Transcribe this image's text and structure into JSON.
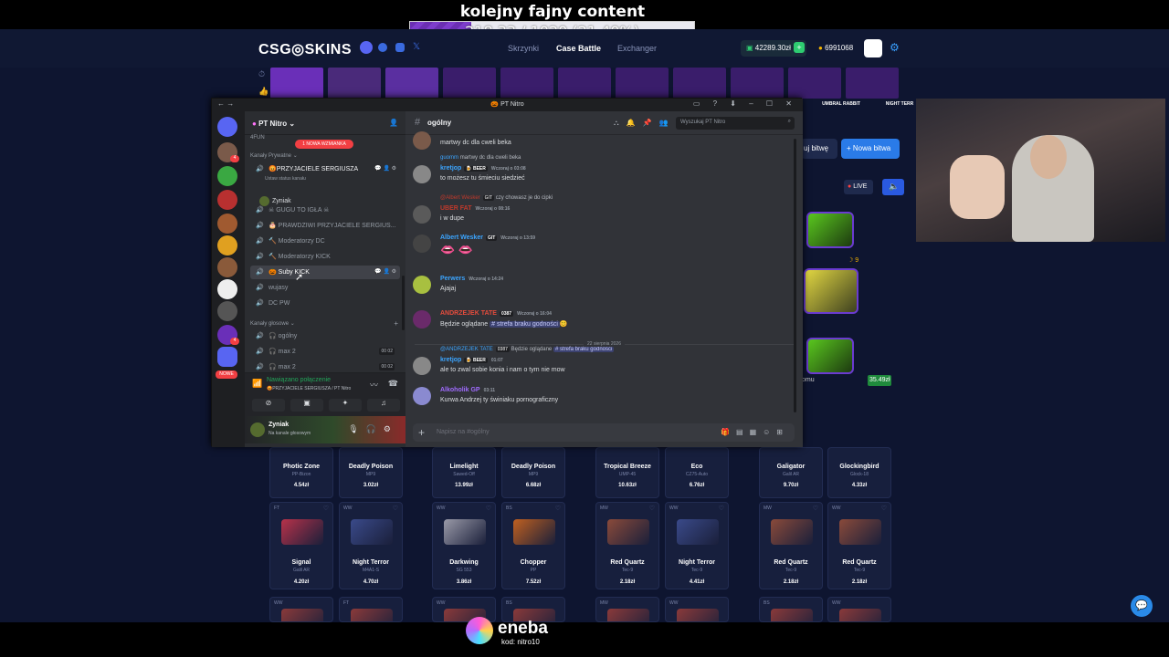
{
  "stream": {
    "title": "kolejny fajny content",
    "goal_text": "218.33 / 1020 (21.40%)",
    "goal_fraction": 0.214
  },
  "site": {
    "logo": "CSG◎SKINS",
    "nav": [
      "Skrzynki",
      "Case Battle",
      "Exchanger"
    ],
    "balance": "42289.30zł",
    "coins": "6991068",
    "join_label": "uj bitwę",
    "new_battle_label": "+ Nowa bitwa",
    "live_label": "LIVE",
    "right_label": "omu",
    "right_price": "35.49zł",
    "mini_count": "9",
    "drops": [
      {
        "color": "#6a2fb8"
      },
      {
        "color": "#4a2a7a"
      },
      {
        "color": "#5a2fa0"
      },
      {
        "color": "#3a1d6b"
      },
      {
        "color": "#3a1d6b"
      },
      {
        "color": "#3a1d6b"
      },
      {
        "color": "#3a1d6b"
      },
      {
        "color": "#3a1d6b"
      },
      {
        "color": "#3a1d6b"
      },
      {
        "color": "#3a1d6b"
      },
      {
        "color": "#3a1d6b"
      }
    ],
    "drop_labels": [
      "UMBRAL RABBIT",
      "NIGHT TERR"
    ],
    "top_cards": [
      {
        "name": "Photic Zone",
        "sub": "PP-Bizon",
        "price": "4.54zł"
      },
      {
        "name": "Deadly Poison",
        "sub": "MP9",
        "price": "3.02zł"
      },
      {
        "name": "Limelight",
        "sub": "Sawed-Off",
        "price": "13.99zł"
      },
      {
        "name": "Deadly Poison",
        "sub": "MP9",
        "price": "6.68zł"
      },
      {
        "name": "Tropical Breeze",
        "sub": "UMP-45",
        "price": "10.63zł"
      },
      {
        "name": "Eco",
        "sub": "CZ75-Auto",
        "price": "6.76zł"
      },
      {
        "name": "Galigator",
        "sub": "Galil AR",
        "price": "9.70zł"
      },
      {
        "name": "Glockingbird",
        "sub": "Glock-18",
        "price": "4.33zł"
      }
    ],
    "cards": [
      {
        "cond": "FT",
        "name": "Signal",
        "sub": "Galil AR",
        "price": "4.20zł",
        "color": "#b8324a"
      },
      {
        "cond": "WW",
        "name": "Night Terror",
        "sub": "M4A1-S",
        "price": "4.70zł",
        "color": "#3a4a8a"
      },
      {
        "cond": "WW",
        "name": "Darkwing",
        "sub": "SG 553",
        "price": "3.86zł",
        "color": "#9a9aa8"
      },
      {
        "cond": "BS",
        "name": "Chopper",
        "sub": "PP",
        "price": "7.52zł",
        "color": "#c06020"
      },
      {
        "cond": "MW",
        "name": "Red Quartz",
        "sub": "Tec-9",
        "price": "2.18zł",
        "color": "#8a4a3a"
      },
      {
        "cond": "WW",
        "name": "Night Terror",
        "sub": "Tec-9",
        "price": "4.41zł",
        "color": "#3a4a8a"
      },
      {
        "cond": "MW",
        "name": "Red Quartz",
        "sub": "Tec-9",
        "price": "2.18zł",
        "color": "#8a4a3a"
      },
      {
        "cond": "WW",
        "name": "Red Quartz",
        "sub": "Tec-9",
        "price": "2.18zł",
        "color": "#8a4a3a"
      }
    ],
    "bottom_conds": [
      "WW",
      "FT",
      "WW",
      "BS",
      "MW",
      "WW",
      "BS",
      "WW"
    ]
  },
  "discord": {
    "window_title": "PT Nitro",
    "server_name": "PT Nitro",
    "mention_badge": "1 NOWA WZMIANKA",
    "nowe_badge": "NOWE",
    "guild_badges": [
      "4",
      "4"
    ],
    "categories": {
      "top": "4FUN",
      "private": "Kanały Prywatne",
      "voice": "Kanały głosowe"
    },
    "channel_status_hint": "Ustaw status kanału",
    "private_channels": [
      {
        "icon": "🔊",
        "name": "😡PRZYJACIELE SERGIUSZA",
        "bold": true,
        "tools": "💬 👤 ⚙"
      },
      {
        "icon": "🔊",
        "name": "☠ GUGU TO IGŁA ☠"
      },
      {
        "icon": "🔊",
        "name": "🎂 PRAWDZIWI PRZYJACIELE SERGIUS..."
      },
      {
        "icon": "🔊",
        "name": "🔨 Moderatorzy DC"
      },
      {
        "icon": "🔊",
        "name": "🔨 Moderatorzy KICK"
      },
      {
        "icon": "🔊",
        "name": "🎃 Suby KICK",
        "selected": true,
        "tools": "💬 👤 ⚙"
      },
      {
        "icon": "🔊",
        "name": "wujasy"
      },
      {
        "icon": "🔊",
        "name": "DC PW"
      }
    ],
    "voice_user": "Zyniak",
    "voice_channels": [
      {
        "icon": "🔊",
        "name": "🎧 ogólny"
      },
      {
        "icon": "🔊",
        "name": "🎧 max 2",
        "count": "00 02"
      },
      {
        "icon": "🔊",
        "name": "🎧 max 2",
        "count": "00 02"
      }
    ],
    "voice_panel": {
      "status": "Nawiązano połączenie",
      "sub": "😡PRZYJACIELE SERGIUSZA / PT Nitro"
    },
    "user": {
      "name": "Zyniak",
      "status": "Na kanale głosowym"
    },
    "chat": {
      "channel": "ogólny",
      "search_placeholder": "Wyszukaj PT Nitro",
      "composer_placeholder": "Napisz na #ogólny",
      "date_divider": "22 sierpnia 2026",
      "messages": [
        {
          "text": "martwy dc dla cweli beka"
        },
        {
          "reply_author": "guomm",
          "reply": "martwy dc dla cweli beka",
          "author": "kretjop",
          "author_color": "#3ba5ff",
          "role": "🍺 BEER",
          "time": "Wczoraj o 03:08",
          "text": "to możesz tu śmieciu siedzieć"
        },
        {
          "reply_author": "@Albert Wesker",
          "reply_role": "GIT",
          "reply": "czy chowasz je do cipki",
          "author": "UBER FAT",
          "author_color": "#c0392b",
          "time": "Wczoraj o 08:16",
          "text": "i w dupe"
        },
        {
          "author": "Albert Wesker",
          "author_color": "#3ba5ff",
          "role": "GIT",
          "time": "Wczoraj o 13:59",
          "text": "👄 👄"
        },
        {
          "author": "Perwers",
          "author_color": "#3ba5ff",
          "time": "Wczoraj o 14:24",
          "text": "Ajajaj"
        },
        {
          "author": "ANDRZEJEK TATE",
          "author_color": "#e74c3c",
          "role": "0387",
          "time": "Wczoraj o 16:04",
          "text": "Będzie oglądane",
          "mention": "# strefa braku godności",
          "emoji": "😊"
        },
        {
          "reply_author": "@ANDRZEJEK TATE",
          "reply_role": "0387",
          "reply": "Będzie oglądane",
          "reply_mention": "# strefa braku godności",
          "author": "kretjop",
          "author_color": "#3ba5ff",
          "role": "🍺 BEER",
          "time": "01:07",
          "text": "ale to zwal sobie konia i nam o tym nie mow"
        },
        {
          "author": "Alkoholik GP",
          "author_color": "#a06bff",
          "time": "03:11",
          "text": "Kurwa Andrzej ty świniaku pornograficzny"
        }
      ]
    }
  },
  "eneba": {
    "name": "eneba",
    "code": "kod: nitro10"
  }
}
